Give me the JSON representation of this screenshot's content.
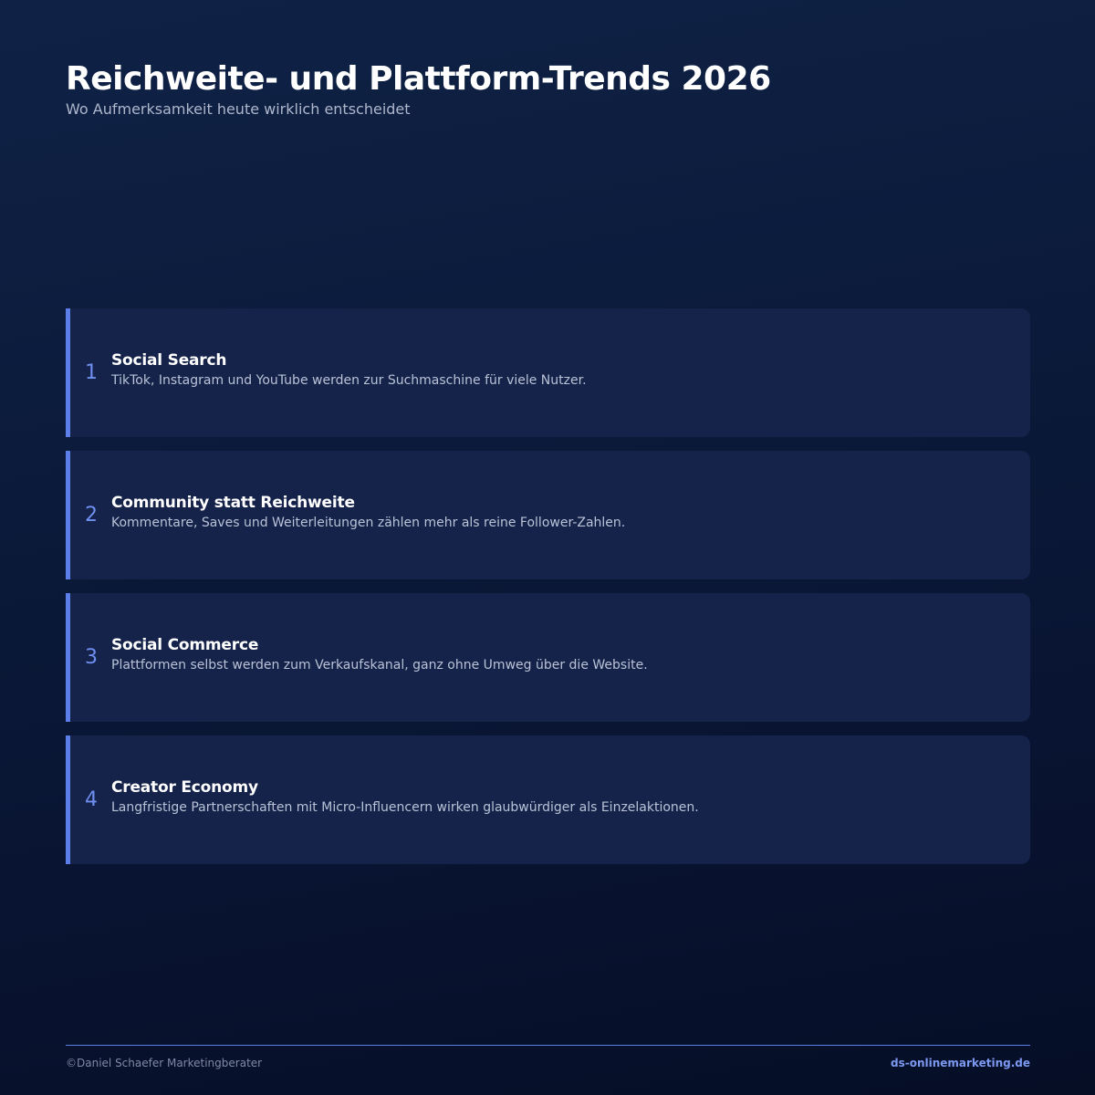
{
  "header": {
    "title": "Reichweite- und Plattform-Trends 2026",
    "subtitle": "Wo Aufmerksamkeit heute wirklich entscheidet"
  },
  "trends": [
    {
      "number": "1",
      "title": "Social Search",
      "description": "TikTok, Instagram und YouTube werden zur Suchmaschine für viele Nutzer."
    },
    {
      "number": "2",
      "title": "Community statt Reichweite",
      "description": "Kommentare, Saves und Weiterleitungen zählen mehr als reine Follower-Zahlen."
    },
    {
      "number": "3",
      "title": "Social Commerce",
      "description": "Plattformen selbst werden zum Verkaufskanal, ganz ohne Umweg über die Website."
    },
    {
      "number": "4",
      "title": "Creator Economy",
      "description": "Langfristige Partnerschaften mit Micro-Influencern wirken glaubwürdiger als Einzelaktionen."
    }
  ],
  "footer": {
    "copyright": "©Daniel Schaefer Marketingberater",
    "website": "ds-onlinemarketing.de"
  },
  "colors": {
    "accent": "#5b7ee8",
    "background": "#0b1a3a",
    "card": "#15234a"
  }
}
